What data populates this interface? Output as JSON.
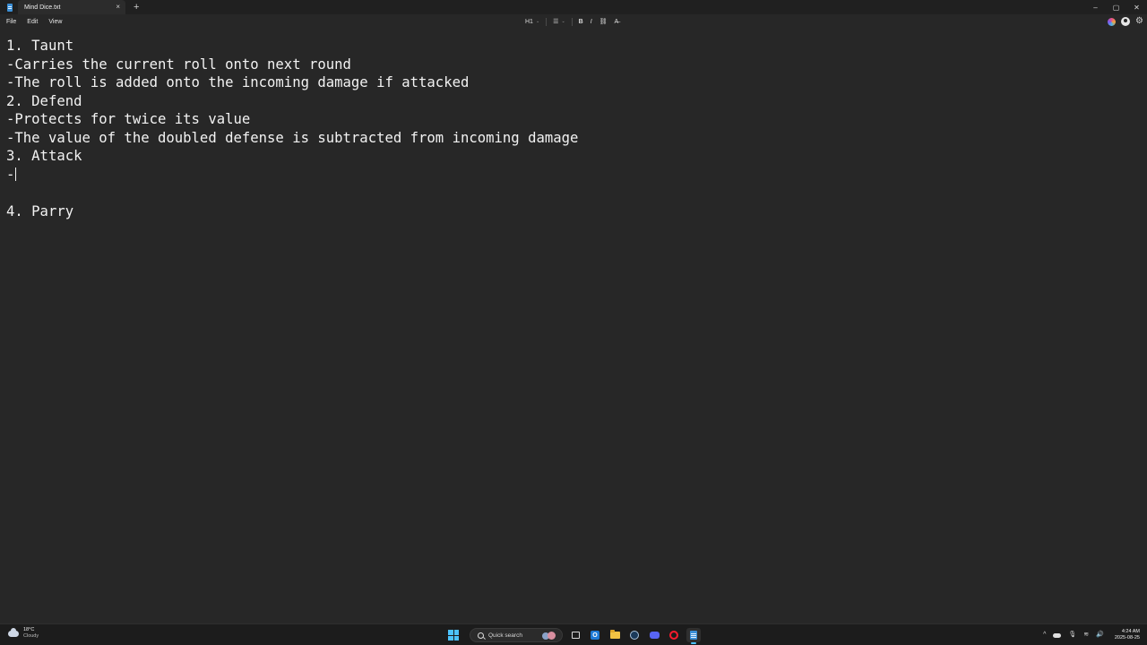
{
  "window": {
    "tab_title": "Mind Dice.txt",
    "tab_close": "×",
    "tab_add": "+",
    "minimize": "–",
    "maximize": "▢",
    "close": "✕"
  },
  "menu": {
    "file": "File",
    "edit": "Edit",
    "view": "View"
  },
  "toolbar": {
    "heading": "H1",
    "list_icon": "☰",
    "bold": "B",
    "italic": "I",
    "link_icon": "⛓",
    "clear_format_icon": "A̶",
    "chevron": "⌄"
  },
  "editor": {
    "lines": [
      "1. Taunt",
      "-Carries the current roll onto next round",
      "-The roll is added onto the incoming damage if attacked",
      "2. Defend",
      "-Protects for twice its value",
      "-The value of the doubled defense is subtracted from incoming damage",
      "3. Attack",
      "-",
      "",
      "4. Parry"
    ]
  },
  "taskbar": {
    "weather_temp": "18°C",
    "weather_condition": "Cloudy",
    "search_placeholder": "Quick search",
    "outlook_letter": "O",
    "tray_chevron": "^",
    "tray_mic": "🎙",
    "tray_wifi": "≋",
    "tray_volume": "🔊",
    "time": "4:24 AM",
    "date": "2025-08-25"
  },
  "colors": {
    "background": "#272727",
    "titlebar": "#202020",
    "taskbar": "#1c1c1c",
    "accent": "#4cc2ff",
    "text": "#f2f2f2"
  }
}
